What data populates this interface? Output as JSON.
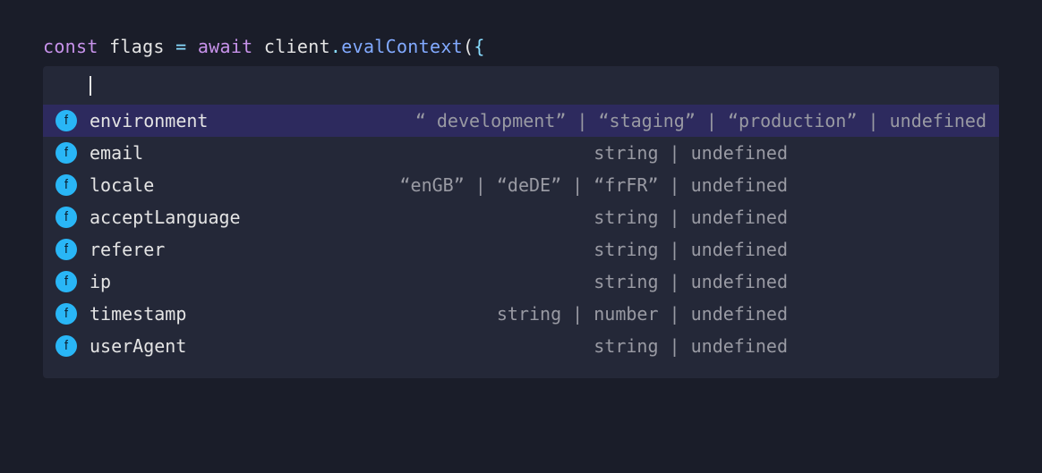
{
  "code": {
    "const": "const",
    "varName": "flags",
    "equals": "=",
    "await": "await",
    "object": "client",
    "dot": ".",
    "method": "evalContext",
    "openParen": "(",
    "openBrace": "{"
  },
  "suggestions": [
    {
      "icon": "f",
      "name": "environment",
      "type": "“ development” | “staging” | “production” | undefined",
      "selected": true
    },
    {
      "icon": "f",
      "name": "email",
      "type": "string | undefined",
      "selected": false
    },
    {
      "icon": "f",
      "name": "locale",
      "type": "“enGB” | “deDE” | “frFR” | undefined",
      "selected": false
    },
    {
      "icon": "f",
      "name": "acceptLanguage",
      "type": "string | undefined",
      "selected": false
    },
    {
      "icon": "f",
      "name": "referer",
      "type": "string | undefined",
      "selected": false
    },
    {
      "icon": "f",
      "name": "ip",
      "type": "string | undefined",
      "selected": false
    },
    {
      "icon": "f",
      "name": "timestamp",
      "type": "string | number | undefined",
      "selected": false
    },
    {
      "icon": "f",
      "name": "userAgent",
      "type": "string | undefined",
      "selected": false
    }
  ]
}
